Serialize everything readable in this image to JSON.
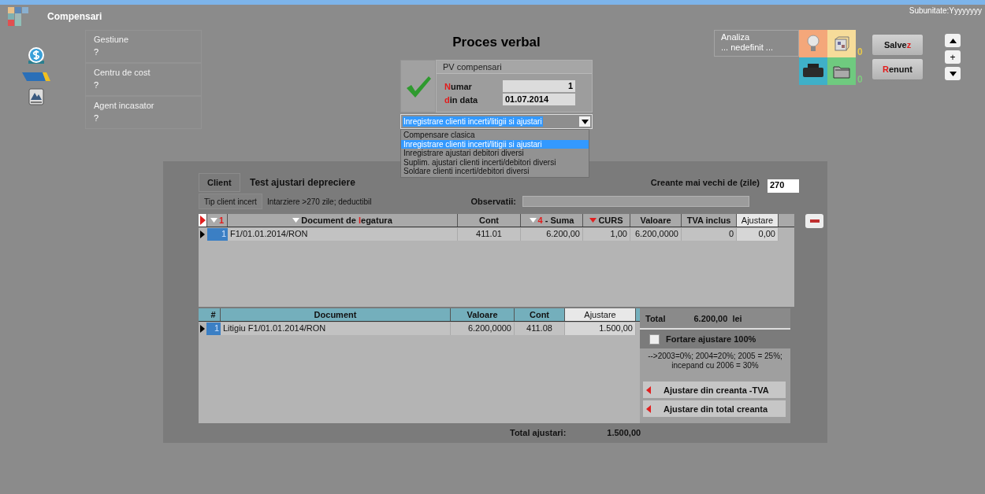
{
  "window": {
    "title": "Compensari",
    "subunit": "Subunitate:Yyyyyyyy"
  },
  "info_fields": [
    {
      "label": "Gestiune",
      "value": "?"
    },
    {
      "label": "Centru de cost",
      "value": "?"
    },
    {
      "label": "Agent incasator",
      "value": "?"
    }
  ],
  "document": {
    "title": "Proces verbal",
    "type": "PV compensari",
    "validated": true,
    "fields": [
      {
        "label": {
          "key": "N",
          "after": "umar"
        },
        "value": "1"
      },
      {
        "label": {
          "key": "d",
          "after": "in data"
        },
        "value": "01.07.2014"
      }
    ],
    "combo": {
      "value": "Inregistrare clienti incerti/litigii si ajustari",
      "open": true,
      "options": [
        {
          "label": "Compensare clasica",
          "selected": false
        },
        {
          "label": "Inregistrare clienti incerti/litigii si ajustari",
          "selected": true
        },
        {
          "label": "Inregistrare ajustari debitori diversi",
          "selected": false
        },
        {
          "label": "Suplim. ajustari clienti incerti/debitori diversi",
          "selected": false
        },
        {
          "label": "Soldare clienti incerti/debitori diversi",
          "selected": false
        }
      ]
    }
  },
  "analysis": {
    "label": "Analiza",
    "value": "... nedefinit ..."
  },
  "counters": [
    {
      "text": "0",
      "color": "#e8c84a"
    },
    {
      "text": "0",
      "color": "#7fc97f"
    }
  ],
  "buttons": [
    {
      "label": {
        "before": "Salve",
        "key": "z"
      }
    },
    {
      "label": {
        "key": "R",
        "after": "enunt"
      }
    }
  ],
  "nav": [
    {
      "kind": "up"
    },
    {
      "kind": "plus",
      "text": "+"
    },
    {
      "kind": "down"
    }
  ],
  "client": {
    "label": "Client",
    "name": "Test ajustari depreciere"
  },
  "client_type": {
    "button": "Tip client incert",
    "value": "Intarziere >270 zile; deductibil"
  },
  "older_than": {
    "label": "Creante mai vechi de (zile)",
    "value": "270"
  },
  "observations": {
    "label": "Observatii:"
  },
  "documents_table": {
    "columns": [
      {
        "label": {
          "key": "1"
        },
        "sorted": true,
        "color": "#ffffff",
        "editable": false
      },
      {
        "label": {
          "before": "Document de ",
          "key": "l",
          "after": "egatura"
        },
        "sorted": true,
        "color": "#ffffff",
        "editable": false
      },
      {
        "label": {
          "before": "Cont"
        },
        "sorted": false,
        "editable": false
      },
      {
        "label": {
          "key": "4",
          "after": " - Suma"
        },
        "sorted": true,
        "color": "#ffffff",
        "editable": false
      },
      {
        "label": {
          "before": "CURS"
        },
        "sorted": true,
        "color": "#e02020",
        "editable": false
      },
      {
        "label": {
          "before": "Valoare"
        },
        "sorted": false,
        "editable": false
      },
      {
        "label": {
          "before": "TVA inclus"
        },
        "sorted": false,
        "editable": false
      },
      {
        "label": {
          "before": "Ajustare"
        },
        "sorted": false,
        "editable": true
      }
    ],
    "rows": [
      {
        "selected": true,
        "cells": [
          "1",
          "F1/01.01.2014/RON",
          "411.01",
          "6.200,00",
          "1,00",
          "6.200,0000",
          "0",
          "0,00"
        ]
      }
    ]
  },
  "adjustments_table": {
    "columns": [
      {
        "label": {
          "before": "#"
        },
        "editable": false
      },
      {
        "label": {
          "before": "Document"
        },
        "editable": false
      },
      {
        "label": {
          "before": "Valoare"
        },
        "editable": false
      },
      {
        "label": {
          "before": "Cont"
        },
        "editable": false
      },
      {
        "label": {
          "before": "Ajustare"
        },
        "editable": true
      }
    ],
    "rows": [
      {
        "selected": true,
        "cells": [
          "1",
          "Litigiu F1/01.01.2014/RON",
          "6.200,0000",
          "411.08",
          "1.500,00"
        ]
      }
    ]
  },
  "summary": {
    "total_label": "Total",
    "total_value": "6.200,00",
    "currency": "lei",
    "force": {
      "label": "Fortare ajustare 100%",
      "checked": false
    },
    "note": [
      "-->2003=0%; 2004=20%;  2005 = 25%;",
      "incepand cu 2006 = 30%"
    ],
    "actions": [
      "Ajustare din creanta -TVA",
      "Ajustare din total creanta"
    ]
  },
  "total_adjustments": {
    "label": "Total ajustari:",
    "value": "1.500,00"
  }
}
